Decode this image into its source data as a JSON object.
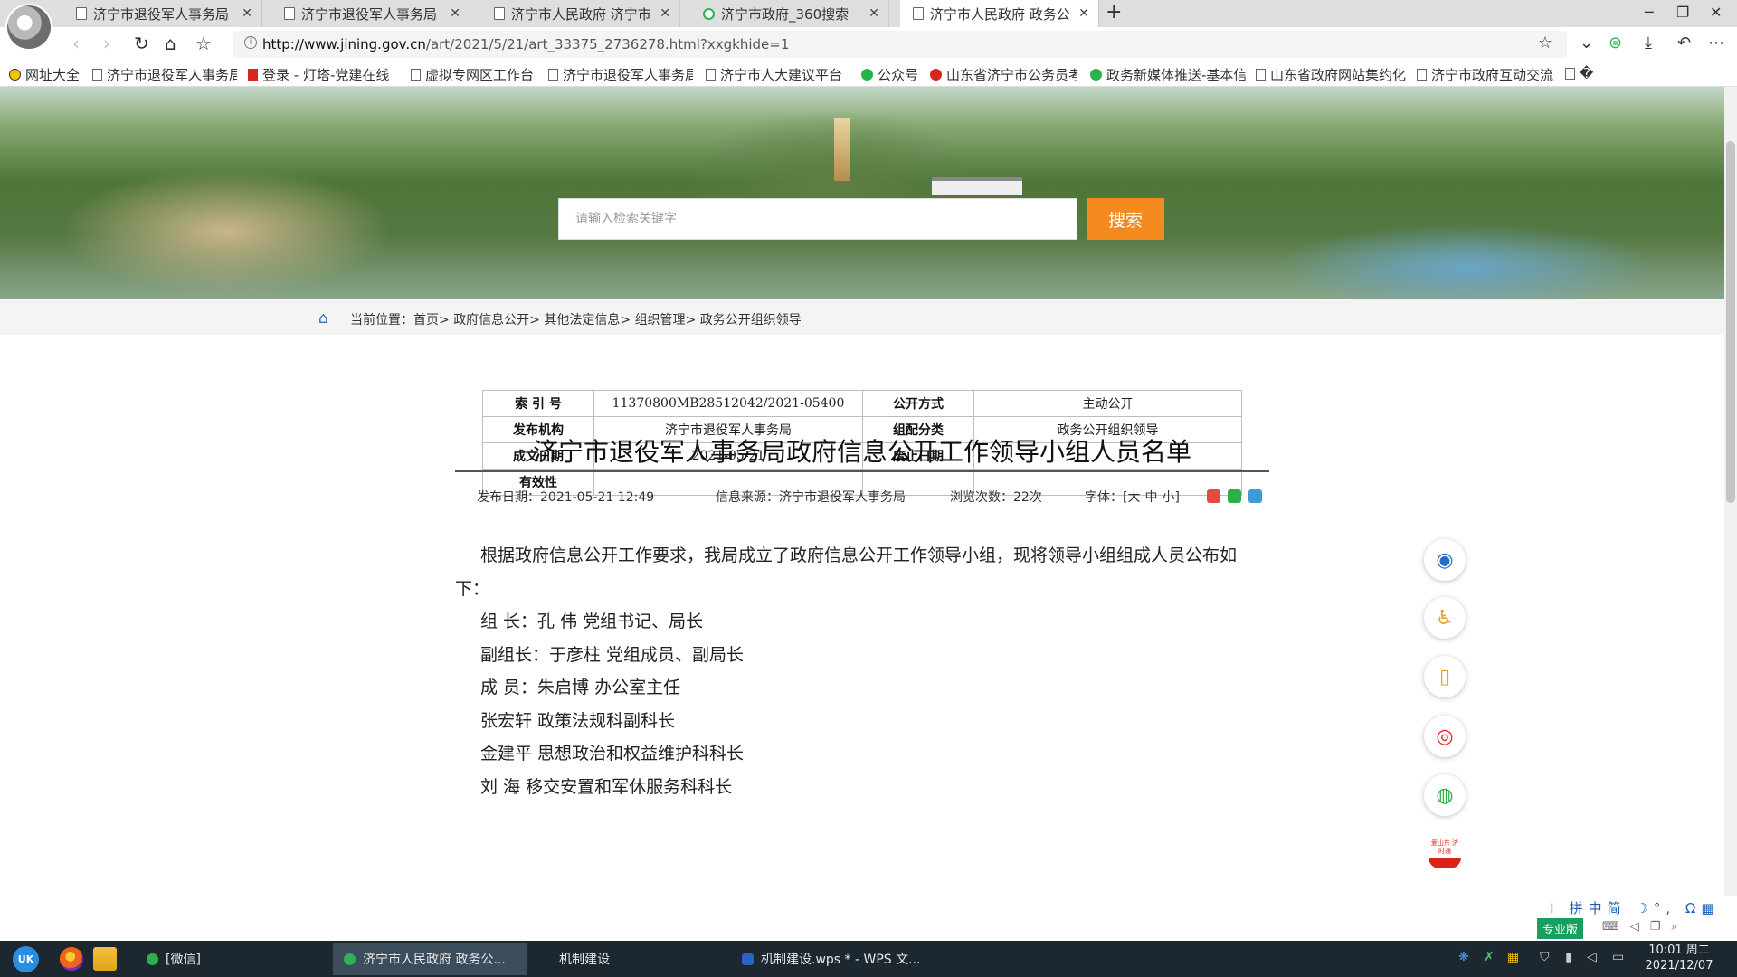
{
  "browser": {
    "tabs": [
      {
        "title": "济宁市退役军人事务局",
        "active": false
      },
      {
        "title": "济宁市退役军人事务局",
        "active": false
      },
      {
        "title": "济宁市人民政府 济宁市",
        "active": false
      },
      {
        "title": "济宁市政府_360搜索",
        "active": false
      },
      {
        "title": "济宁市人民政府 政务公",
        "active": true
      }
    ],
    "new_tab": "+",
    "url_host": "http://www.jining.gov.cn",
    "url_path": "/art/2021/5/21/art_33375_2736278.html?xxgkhide=1",
    "bookmarks": [
      "网址大全",
      "济宁市退役军人事务局",
      "登录 - 灯塔-党建在线",
      "虚拟专网区工作台",
      "济宁市退役军人事务局",
      "济宁市人大建议平台",
      "公众号",
      "山东省济宁市公务员考",
      "政务新媒体推送-基本信",
      "山东省政府网站集约化",
      "济宁市政府互动交流",
      "�"
    ]
  },
  "page": {
    "search": {
      "placeholder": "请输入检索关键字",
      "button": "搜索"
    },
    "breadcrumb": {
      "prefix": "当前位置：",
      "items": [
        "首页",
        "政府信息公开",
        "其他法定信息",
        "组织管理",
        "政务公开组织领导"
      ],
      "sep": ">"
    },
    "meta": {
      "index_label": "索 引 号",
      "index_value": "11370800MB28512042/2021-05400",
      "open_label": "公开方式",
      "open_value": "主动公开",
      "org_label": "发布机构",
      "org_value": "济宁市退役军人事务局",
      "cat_label": "组配分类",
      "cat_value": "政务公开组织领导",
      "date_label": "成文日期",
      "date_value": "2021-05-21",
      "expire_label": "废止日期",
      "expire_value": "",
      "valid_label": "有效性",
      "valid_value": ""
    },
    "title": "济宁市退役军人事务局政府信息公开工作领导小组人员名单",
    "info": {
      "pub_date": "发布日期：2021-05-21 12:49",
      "source": "信息来源：济宁市退役军人事务局",
      "views": "浏览次数：22次",
      "font_label": "字体：[",
      "font_large": "大",
      "font_medium": "中",
      "font_small": "小",
      "font_close": "]"
    },
    "article": {
      "intro_1": "根据政府信息公开工作要求，我局成立了政府信息公开工作领导小组，现将领导小组组成人员公布如",
      "intro_2": "下：",
      "lines": [
        "组 长：孔 伟  党组书记、局长",
        "副组长：于彦柱 党组成员、副局长",
        "成 员：朱启博  办公室主任",
        "张宏轩  政策法规科副科长",
        "金建平  思想政治和权益维护科科长",
        "刘 海  移交安置和军休服务科科长"
      ]
    },
    "float_labels": {
      "shandong": "爱山东 济时通"
    }
  },
  "ime": {
    "row1": "拼中简",
    "badge": "专业版"
  },
  "taskbar": {
    "start": "UK",
    "tasks": [
      "[微信]",
      "济宁市人民政府 政务公...",
      "机制建设",
      "机制建设.wps * - WPS 文..."
    ],
    "time": "10:01 周二",
    "date": "2021/12/07"
  },
  "colors": {
    "accent_orange": "#f28a1e",
    "link_blue": "#3a6db5",
    "ime_green": "#16a05d",
    "taskbar": "#1d2730"
  }
}
